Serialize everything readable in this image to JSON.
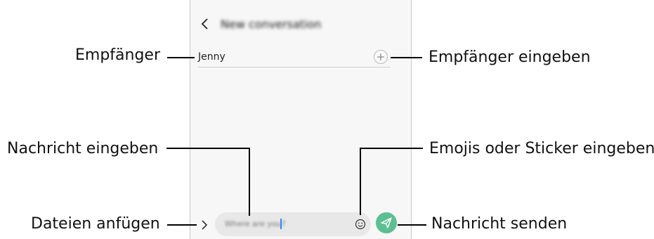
{
  "screen": {
    "title": "New conversation",
    "recipient": "Jenny",
    "message_placeholder": "Where are you?"
  },
  "callouts": {
    "recipient": "Empfänger",
    "enter_recipient": "Empfänger eingeben",
    "enter_message": "Nachricht eingeben",
    "enter_emoji": "Emojis oder Sticker eingeben",
    "attach_files": "Dateien anfügen",
    "send_message": "Nachricht senden"
  },
  "icons": {
    "back": "chevron-left-icon",
    "add": "plus-icon",
    "attach": "chevron-right-icon",
    "emoji": "smiley-icon",
    "send": "paper-plane-icon"
  },
  "colors": {
    "send_button": "#5bbf91",
    "cursor": "#2d8aff"
  }
}
